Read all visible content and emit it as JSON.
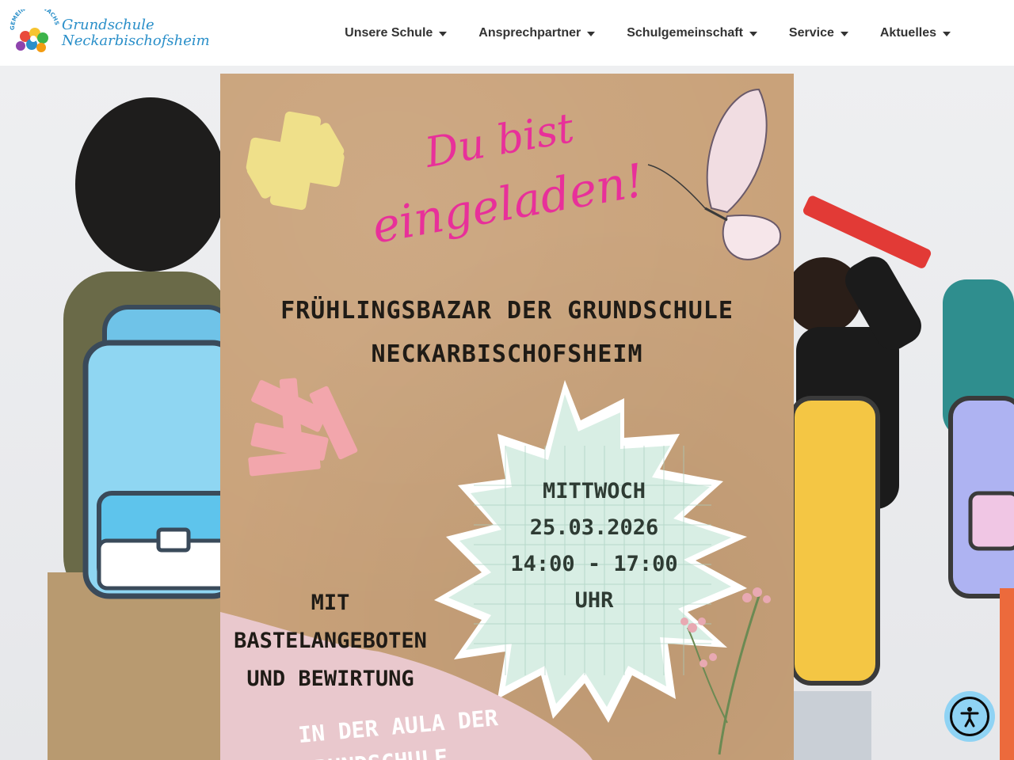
{
  "logo": {
    "arc_text": "GEMEINSAM WACHSEN",
    "line1": "Grundschule",
    "line2": "Neckarbischofsheim"
  },
  "nav": {
    "items": [
      {
        "label": "Unsere Schule"
      },
      {
        "label": "Ansprechpartner"
      },
      {
        "label": "Schulgemeinschaft"
      },
      {
        "label": "Service"
      },
      {
        "label": "Aktuelles"
      }
    ]
  },
  "flyer": {
    "script_line1": "Du bist",
    "script_line2": "eingeladen!",
    "headline_line1": "FRÜHLINGSBAZAR DER GRUNDSCHULE",
    "headline_line2": "NECKARBISCHOFSHEIM",
    "side_line1": "MIT",
    "side_line2": "BASTELANGEBOTEN",
    "side_line3": "UND BEWIRTUNG",
    "day": "MITTWOCH",
    "date": "25.03.2026",
    "time": "14:00 - 17:00 UHR",
    "aula_line1": "IN DER AULA DER",
    "aula_line2": "GRUNDSCHULE"
  },
  "colors": {
    "brand_blue": "#2a8fc9",
    "script_pink": "#e8309a",
    "kraft": "#c9a27a",
    "accessibility": "#8fd3f4"
  },
  "icons": {
    "nav_caret": "caret-down-icon",
    "accessibility": "accessibility-icon"
  }
}
